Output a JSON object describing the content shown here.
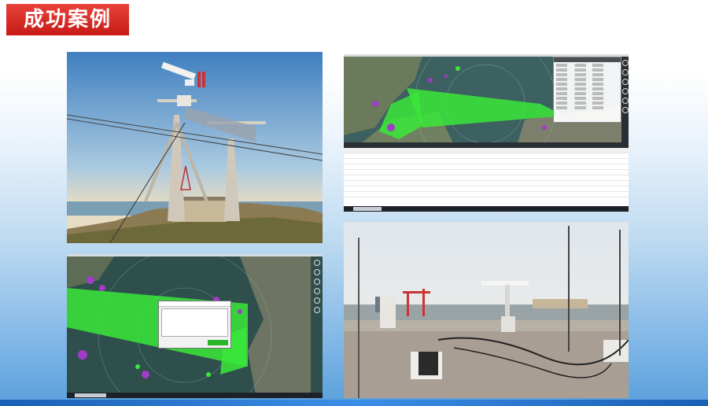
{
  "header": {
    "title": "成功案例"
  },
  "photos": [
    {
      "name": "radar-mast-photo",
      "subject": "radar mast on hilltop"
    },
    {
      "name": "radar-software-map-table",
      "subject": "radar software with map and data table"
    },
    {
      "name": "radar-software-dialog",
      "subject": "radar software map with dialog"
    },
    {
      "name": "rooftop-radar-photo",
      "subject": "rooftop radar installation"
    }
  ],
  "colors": {
    "title_bg": "#d9251e",
    "radar_track": "#39e83a",
    "target_purple": "#a03cc8"
  }
}
